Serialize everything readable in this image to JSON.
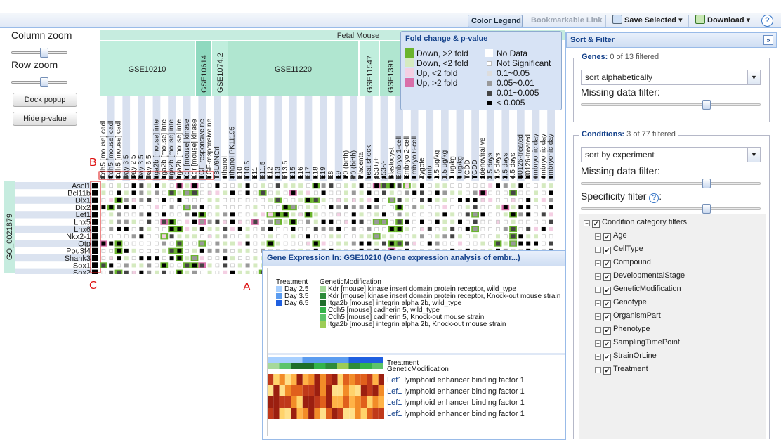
{
  "toolbar": {
    "color_legend": "Color Legend",
    "bookmarkable": "Bookmarkable Link",
    "save_selected": "Save Selected",
    "download": "Download",
    "help": "?"
  },
  "left": {
    "column_zoom": "Column zoom",
    "row_zoom": "Row zoom",
    "dock_popup": "Dock popup",
    "hide_pvalue": "Hide p-value"
  },
  "heatmap": {
    "top_label": "Fetal Mouse",
    "experiments": [
      "GSE10210",
      "GSE10614",
      "GSE1074.2",
      "GSE11220",
      "GSE11547",
      "GSE1391"
    ],
    "conditions": [
      "Cdh5 [mouse] cadl",
      "Cdh5 [mouse] cadl",
      "Cdh5 [mouse] cadl",
      "Day 3.5",
      "Day 2.5",
      "Day 3.5",
      "Day 6.5",
      "Itga2b [mouse] inte",
      "Itga2b [mouse] inte",
      "Itga2b [mouse] inte",
      "Itga2b [mouse] inte",
      "Kdr [mouse] kinase",
      "Kdr [mouse] kinase",
      "FGF-responsive ne",
      "EGF-responsive ne",
      "TBL/6NCrl",
      "ethanol",
      "ethanol PK11195",
      "E10",
      "E10.5",
      "E11",
      "E11.5",
      "E12",
      "E13",
      "E13.5",
      "E15",
      "E16",
      "E17",
      "E18",
      "E19",
      "E8",
      "E9",
      "P0 (birth)",
      "P0 (birth)",
      "Placenta",
      "heat shock",
      "p53+/+",
      "p53-/-",
      "Blastocyst",
      "Embryo 1-cell",
      "Embryo 2-cell",
      "Embryo 8-cell",
      "Zygote",
      "emb",
      "1.5 ug/kg",
      "1.5 ug/kg",
      "3 ug/kg",
      "6 ug/kg",
      "TCDD",
      "TCDD",
      "adenoviral ve",
      "2.5 days",
      "3.5 days",
      "3.5 days",
      "4.5 days",
      "U0126-treated",
      "U0126-treated",
      "embryonic day",
      "embryonic day",
      "embryonic day"
    ],
    "go_term": "GO_0021879",
    "genes": [
      "Ascl1",
      "Bcl11b",
      "Dlx1",
      "Dlx2",
      "Lef1",
      "Lhx5",
      "Lhx6",
      "Nkx2-1",
      "Otp",
      "Pou3f4",
      "Shank3",
      "Sox1",
      "Sox2"
    ]
  },
  "annotations": {
    "a": "A",
    "b": "B",
    "c": "C"
  },
  "legend_popup": {
    "title": "Fold change & p-value",
    "fold": [
      {
        "label": "Down, >2 fold",
        "color": "#6ab42d"
      },
      {
        "label": "Down, <2 fold",
        "color": "#d5eac0"
      },
      {
        "label": "Up, <2 fold",
        "color": "#f4cfe3"
      },
      {
        "label": "Up, >2 fold",
        "color": "#d96fa9"
      }
    ],
    "pvalue": [
      "No Data",
      "Not Significant",
      "0.1~0.05",
      "0.05~0.01",
      "0.01~0.005",
      "< 0.005"
    ]
  },
  "gene_popup": {
    "title": "Gene Expression In: GSE10210 (Gene expression analysis of embr...)",
    "close": "×",
    "treatment_title": "Treatment",
    "treatments": [
      {
        "label": "Day 2.5",
        "color": "#a8d0ff"
      },
      {
        "label": "Day 3.5",
        "color": "#5b9cf0"
      },
      {
        "label": "Day 6.5",
        "color": "#1f5fe0"
      }
    ],
    "genmod_title": "GeneticModification",
    "genmods": [
      {
        "label": "Kdr [mouse] kinase insert domain protein receptor, wild_type",
        "color": "#a6d99b"
      },
      {
        "label": "Kdr [mouse] kinase insert domain protein receptor, Knock-out mouse strain",
        "color": "#2e8b3a"
      },
      {
        "label": "Itga2b [mouse] integrin alpha 2b, wild_type",
        "color": "#1e6e2a"
      },
      {
        "label": "Cdh5 [mouse] cadherin 5, wild_type",
        "color": "#33b34a"
      },
      {
        "label": "Cdh5 [mouse] cadherin 5, Knock-out mouse strain",
        "color": "#5cc46a"
      },
      {
        "label": "Itga2b [mouse] integrin alpha 2b, Knock-out mouse strain",
        "color": "#9ccc55"
      }
    ],
    "band_treatment": "Treatment",
    "band_genmod": "GeneticModification",
    "rows": [
      {
        "symbol": "Lef1",
        "name": "lymphoid enhancer binding factor 1"
      },
      {
        "symbol": "Lef1",
        "name": "lymphoid enhancer binding factor 1"
      },
      {
        "symbol": "Lef1",
        "name": "lymphoid enhancer binding factor 1"
      },
      {
        "symbol": "Lef1",
        "name": "lymphoid enhancer binding factor 1"
      }
    ]
  },
  "sort_filter": {
    "title": "Sort & Filter",
    "collapse": "»",
    "genes_label": "Genes:",
    "genes_count": "0",
    "genes_suffix": "of 13 filtered",
    "genes_sort": "sort alphabetically",
    "genes_missing": "Missing data filter:",
    "cond_label": "Conditions:",
    "cond_count": "3",
    "cond_suffix": "of 77 filtered",
    "cond_sort": "sort by experiment",
    "cond_missing": "Missing data filter:",
    "specificity": "Specificity filter",
    "category_root": "Condition category filters",
    "categories": [
      "Age",
      "CellType",
      "Compound",
      "DevelopmentalStage",
      "GeneticModification",
      "Genotype",
      "OrganismPart",
      "Phenotype",
      "SamplingTimePoint",
      "StrainOrLine",
      "Treatment"
    ]
  }
}
